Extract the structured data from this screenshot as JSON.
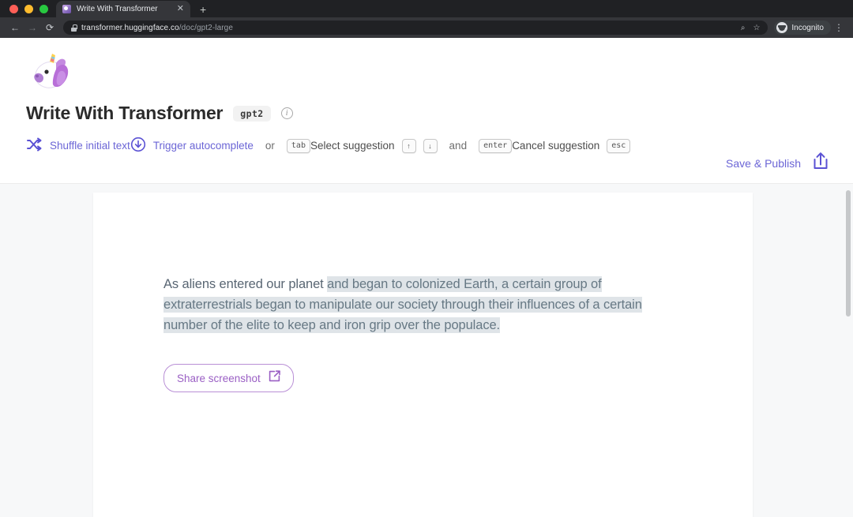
{
  "browser": {
    "tab": {
      "title": "Write With Transformer",
      "favicon": "unicorn-favicon",
      "close": "✕"
    },
    "new_tab": "+",
    "nav": {
      "back": "←",
      "forward": "→",
      "reload": "⟳"
    },
    "url": {
      "host": "transformer.huggingface.co",
      "path": "/doc/gpt2-large",
      "lock": "lock-icon"
    },
    "omni_right": {
      "zoom": "⌕",
      "bookmark": "☆"
    },
    "profile": {
      "label": "Incognito"
    },
    "menu": "⋮"
  },
  "app": {
    "logo_alt": "unicorn-logo",
    "title": "Write With Transformer",
    "model_badge": "gpt2",
    "info_icon": "i",
    "hints": [
      {
        "icon": "shuffle-icon",
        "label": "Shuffle initial text",
        "style": "action"
      },
      {
        "icon": "download-circle-icon",
        "label": "Trigger autocomplete",
        "style": "action",
        "or": "or",
        "keys": [
          "tab"
        ]
      },
      {
        "icon": "",
        "label": "Select suggestion",
        "style": "static",
        "keys": [
          "↑",
          "↓"
        ],
        "and": "and",
        "keys2": [
          "enter"
        ]
      },
      {
        "icon": "",
        "label": "Cancel suggestion",
        "style": "static",
        "keys": [
          "esc"
        ]
      }
    ],
    "publish": {
      "label": "Save & Publish",
      "icon": "share-upload-icon"
    }
  },
  "document": {
    "user_text": "As aliens entered our planet ",
    "generated_text": "and began to colonized Earth, a certain group of extraterrestrials began to manipulate our society through their influences of a certain number of the elite to keep and iron grip over the populace.",
    "share_button": {
      "label": "Share screenshot",
      "icon": "external-link-icon"
    }
  },
  "colors": {
    "accent_purple": "#6b65d6",
    "share_purple": "#9a5fc4",
    "highlight_bg": "#dfe4e8",
    "page_bg": "#f7f8f9",
    "chrome_bg": "#202124"
  }
}
